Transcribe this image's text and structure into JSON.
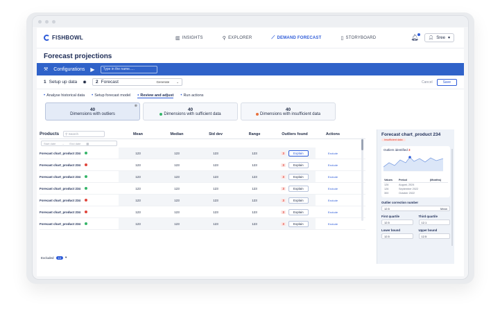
{
  "app": {
    "brand": "FISHBOWL",
    "nav": [
      {
        "label": "INSIGHTS",
        "icon": "bar-chart-icon",
        "active": false
      },
      {
        "label": "EXPLORER",
        "icon": "search-icon",
        "active": false
      },
      {
        "label": "DEMAND FORECAST",
        "icon": "trend-line-icon",
        "active": true
      },
      {
        "label": "STORYBOARD",
        "icon": "document-icon",
        "active": false
      }
    ],
    "user": "Sree"
  },
  "page": {
    "title": "Forecast projections"
  },
  "config": {
    "label": "Configurations",
    "name_placeholder": "Type in the name....."
  },
  "steps": {
    "step1_num": "1",
    "step1_label": "Setup up data",
    "step2_num": "2",
    "step2_label": "Forecast",
    "step2_action": "Generate",
    "cancel": "Cancel",
    "save": "Save"
  },
  "tabs": [
    "Analyse historical data",
    "Setup forecast model",
    "Review and adjust",
    "Run actions"
  ],
  "cards": [
    {
      "count": "40",
      "label": "Dimensions with outliers"
    },
    {
      "count": "40",
      "label": "Dimensions with sufficient data"
    },
    {
      "count": "40",
      "label": "Dimensions with insufficient data"
    }
  ],
  "table": {
    "products_label": "Products",
    "search_placeholder": "Search",
    "headers": [
      "Mean",
      "Median",
      "Std dev",
      "Range",
      "Outliers found",
      "Actions"
    ],
    "start_date": "Start date",
    "end_date": "End date",
    "rows": [
      {
        "name": "Forecast chart_product 234",
        "status": "green",
        "mean": "123",
        "median": "123",
        "std": "123",
        "range": "123",
        "outliers": "3",
        "explain": "Explain",
        "action": "Exclude"
      },
      {
        "name": "Forecast chart_product 234",
        "status": "red",
        "mean": "123",
        "median": "123",
        "std": "123",
        "range": "123",
        "outliers": "3",
        "explain": "Explain",
        "action": "Exclude"
      },
      {
        "name": "Forecast chart_product 234",
        "status": "green",
        "mean": "123",
        "median": "123",
        "std": "123",
        "range": "123",
        "outliers": "3",
        "explain": "Explain",
        "action": "Exclude"
      },
      {
        "name": "Forecast chart_product 234",
        "status": "green",
        "mean": "123",
        "median": "123",
        "std": "123",
        "range": "123",
        "outliers": "3",
        "explain": "Explain",
        "action": "Exclude"
      },
      {
        "name": "Forecast chart_product 234",
        "status": "red",
        "mean": "123",
        "median": "123",
        "std": "123",
        "range": "123",
        "outliers": "3",
        "explain": "Explain",
        "action": "Exclude"
      },
      {
        "name": "Forecast chart_product 234",
        "status": "red",
        "mean": "123",
        "median": "123",
        "std": "123",
        "range": "123",
        "outliers": "3",
        "explain": "Explain",
        "action": "Exclude"
      },
      {
        "name": "Forecast chart_product 234",
        "status": "green",
        "mean": "123",
        "median": "123",
        "std": "123",
        "range": "123",
        "outliers": "3",
        "explain": "Explain",
        "action": "Exclude"
      }
    ],
    "excluded_label": "Excluded",
    "excluded_count": "10"
  },
  "panel": {
    "title": "Forecast chart_product 234",
    "status": "Insufficient data",
    "outliers_label": "Outliers identified",
    "outliers_count": "3",
    "mini_headers": [
      "Values",
      "Period",
      "(Months)"
    ],
    "mini_rows": [
      {
        "value": "126",
        "period": "August, 2024"
      },
      {
        "value": "126",
        "period": "September 2022"
      },
      {
        "value": "300",
        "period": "October 2022"
      }
    ],
    "correction_label": "Outlier correction number",
    "correction_value": "12.5",
    "correction_method": "Mean",
    "q1_label": "First quartile",
    "q1_value": "12.5",
    "q3_label": "Third quartile",
    "q3_value": "12.1",
    "lb_label": "Lower bound",
    "lb_value": "12.5",
    "ub_label": "Upper bound",
    "ub_value": "12.5"
  },
  "colors": {
    "accent": "#2d5bd8",
    "config_bar": "#2f62c9",
    "ok": "#35b569",
    "bad": "#e0443a"
  }
}
